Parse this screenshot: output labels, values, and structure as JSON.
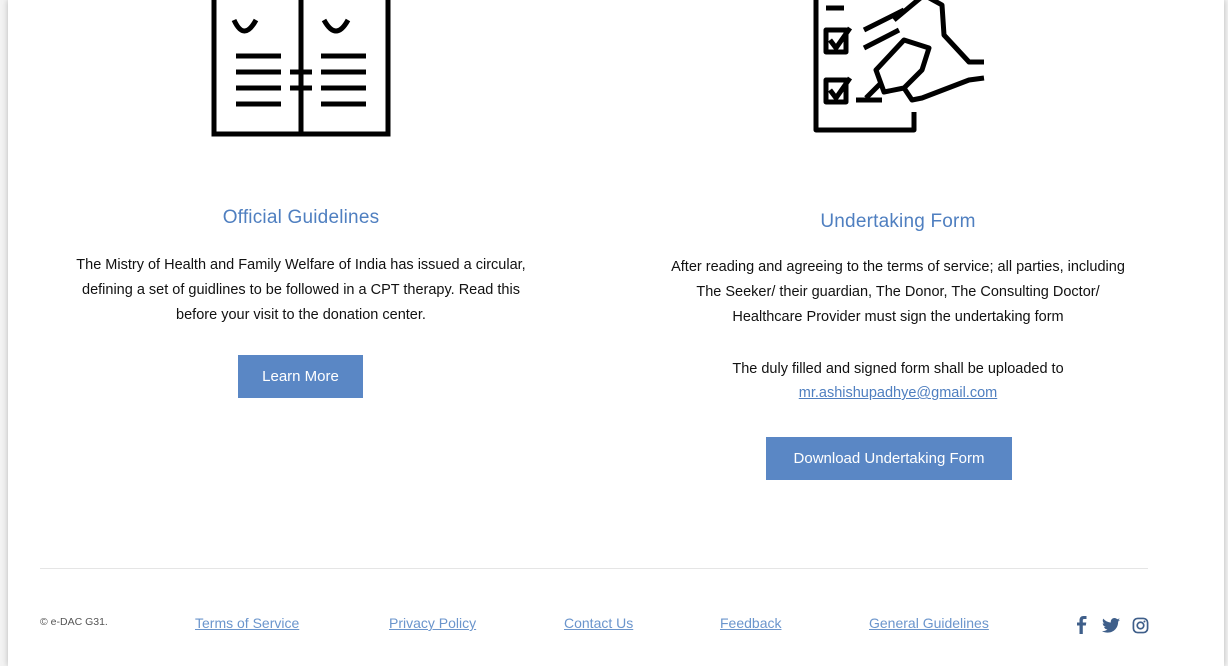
{
  "sections": {
    "guidelines": {
      "title": "Official Guidelines",
      "lines": [
        "The Mistry of Health and Family Welfare of India has issued a circular,",
        "defining a set of guidlines to be followed in a CPT therapy. Read this",
        "before your visit to the donation center."
      ],
      "button_label": "Learn More"
    },
    "undertaking": {
      "title": "Undertaking Form",
      "lines": [
        "After reading and agreeing to the terms of service; all parties, including",
        "The Seeker/ their guardian, The Donor, The Consulting Doctor/",
        "Healthcare Provider must sign the undertaking form"
      ],
      "upload_note": "The duly filled and signed form shall be uploaded to",
      "email": "mr.ashishupadhye@gmail.com",
      "button_label": "Download Undertaking Form"
    }
  },
  "footer": {
    "copyright": "© e-DAC G31.",
    "links": {
      "terms": "Terms of Service",
      "privacy": "Privacy Policy",
      "contact": "Contact Us",
      "feedback": "Feedback",
      "general": "General Guidelines"
    },
    "social_icons": [
      "facebook-icon",
      "twitter-icon",
      "instagram-icon"
    ]
  },
  "colors": {
    "accent": "#4f7fc0",
    "button": "#5a87c5",
    "text": "#111111",
    "footer_link": "#6b95cc"
  }
}
